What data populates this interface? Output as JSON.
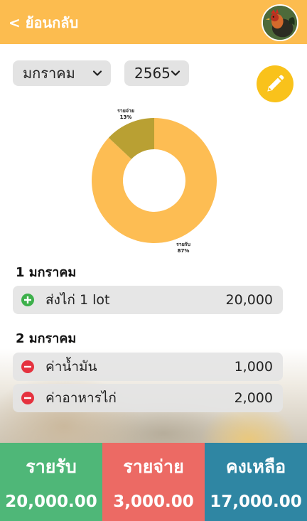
{
  "header": {
    "back_label": "< ย้อนกลับ"
  },
  "filters": {
    "month": "มกราคม",
    "year": "2565"
  },
  "chart_data": {
    "type": "pie",
    "categories": [
      "รายรับ",
      "รายจ่าย"
    ],
    "values": [
      87,
      13
    ],
    "labels": [
      "87%",
      "13%"
    ],
    "colors": [
      "#fdbd53",
      "#b9a033"
    ]
  },
  "groups": [
    {
      "date": "1 มกราคม",
      "items": [
        {
          "type": "income",
          "label": "ส่งไก่ 1 lot",
          "amount": "20,000"
        }
      ]
    },
    {
      "date": "2 มกราคม",
      "items": [
        {
          "type": "expense",
          "label": "ค่าน้ำมัน",
          "amount": "1,000"
        },
        {
          "type": "expense",
          "label": "ค่าอาหารไก่",
          "amount": "2,000"
        }
      ]
    }
  ],
  "summary": {
    "income_title": "รายรับ",
    "income_value": "20,000.00",
    "expense_title": "รายจ่าย",
    "expense_value": "3,000.00",
    "balance_title": "คงเหลือ",
    "balance_value": "17,000.00"
  }
}
